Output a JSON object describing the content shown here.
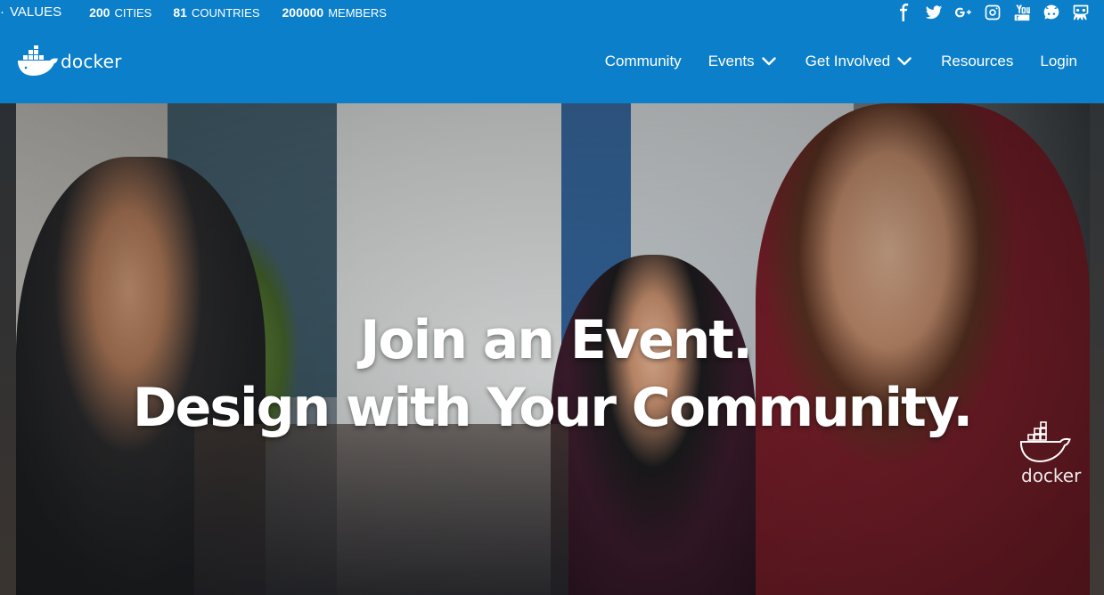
{
  "topbar": {
    "values_label": "VALUES",
    "stats": [
      {
        "number": "200",
        "label": "CITIES"
      },
      {
        "number": "81",
        "label": "COUNTRIES"
      },
      {
        "number": "200000",
        "label": "MEMBERS"
      }
    ],
    "social_icons": [
      "facebook-icon",
      "twitter-icon",
      "google-plus-icon",
      "instagram-icon",
      "youtube-icon",
      "github-icon",
      "slideshare-icon"
    ]
  },
  "navbar": {
    "brand": "docker",
    "items": [
      {
        "label": "Community",
        "dropdown": false
      },
      {
        "label": "Events",
        "dropdown": true
      },
      {
        "label": "Get Involved",
        "dropdown": true
      },
      {
        "label": "Resources",
        "dropdown": false
      },
      {
        "label": "Login",
        "dropdown": false
      }
    ]
  },
  "hero": {
    "headline_line1": "Join an Event.",
    "headline_line2": "Design with Your Community.",
    "shirt_logo_text": "docker"
  },
  "colors": {
    "brand_blue": "#0b7fca",
    "white": "#ffffff"
  }
}
